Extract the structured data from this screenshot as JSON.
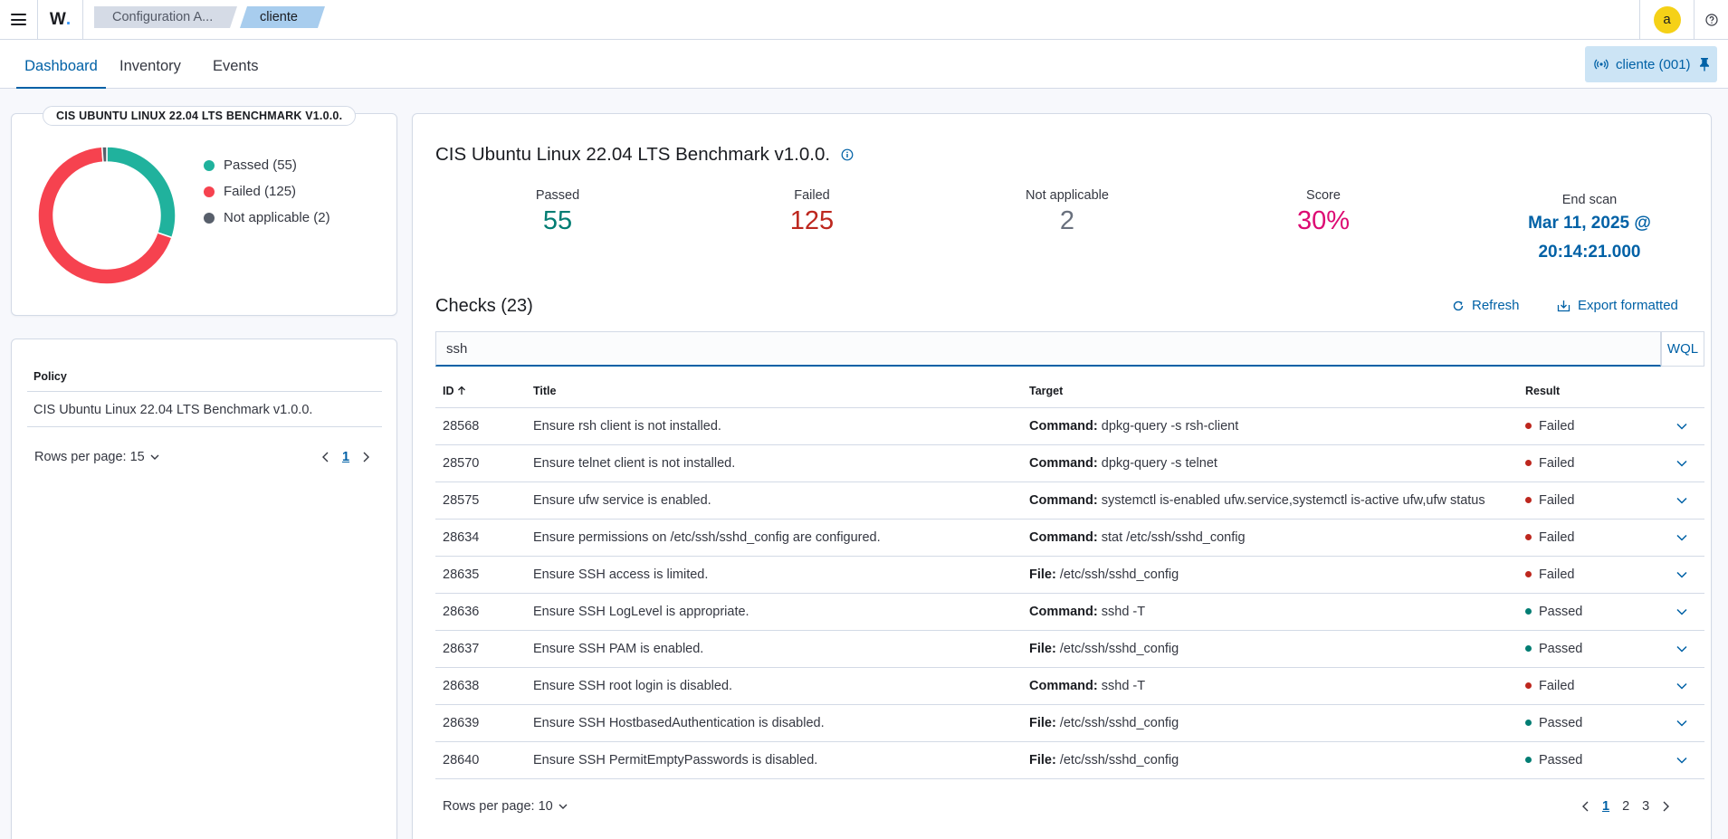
{
  "header": {
    "logo": "W",
    "breadcrumbs": [
      "Configuration A...",
      "cliente"
    ],
    "avatar_letter": "a"
  },
  "tabs": [
    {
      "label": "Dashboard",
      "active": true
    },
    {
      "label": "Inventory",
      "active": false
    },
    {
      "label": "Events",
      "active": false
    }
  ],
  "agent_pill": {
    "label": "cliente (001)"
  },
  "donut": {
    "title": "CIS UBUNTU LINUX 22.04 LTS BENCHMARK V1.0.0.",
    "legend": [
      "Passed (55)",
      "Failed (125)",
      "Not applicable (2)"
    ]
  },
  "chart_data": {
    "type": "pie",
    "title": "CIS UBUNTU LINUX 22.04 LTS BENCHMARK V1.0.0.",
    "categories": [
      "Passed",
      "Failed",
      "Not applicable"
    ],
    "values": [
      55,
      125,
      2
    ],
    "colors": [
      "#20b29d",
      "#f6424f",
      "#585f6b"
    ],
    "legend": "right"
  },
  "policy_table": {
    "header": "Policy",
    "rows": [
      "CIS Ubuntu Linux 22.04 LTS Benchmark v1.0.0."
    ],
    "rows_per_page": "Rows per page: 15",
    "pages": [
      "1"
    ]
  },
  "summary": {
    "title": "CIS Ubuntu Linux 22.04 LTS Benchmark v1.0.0.",
    "stats": [
      {
        "label": "Passed",
        "value": "55",
        "color": "#017d73"
      },
      {
        "label": "Failed",
        "value": "125",
        "color": "#bd271e"
      },
      {
        "label": "Not applicable",
        "value": "2",
        "color": "#69707d"
      },
      {
        "label": "Score",
        "value": "30%",
        "color": "#dd0a73"
      }
    ],
    "end_scan": {
      "label": "End scan",
      "line1": "Mar 11, 2025 @",
      "line2": "20:14:21.000"
    }
  },
  "checks": {
    "title": "Checks (23)",
    "refresh_label": "Refresh",
    "export_label": "Export formatted",
    "search_value": "ssh",
    "wql_label": "WQL",
    "columns": [
      "ID",
      "Title",
      "Target",
      "Result"
    ],
    "rows": [
      {
        "id": "28568",
        "title": "Ensure rsh client is not installed.",
        "target_key": "Command:",
        "target_val": " dpkg-query -s rsh-client",
        "result": "Failed"
      },
      {
        "id": "28570",
        "title": "Ensure telnet client is not installed.",
        "target_key": "Command:",
        "target_val": " dpkg-query -s telnet",
        "result": "Failed"
      },
      {
        "id": "28575",
        "title": "Ensure ufw service is enabled.",
        "target_key": "Command:",
        "target_val": " systemctl is-enabled ufw.service,systemctl is-active ufw,ufw status",
        "result": "Failed"
      },
      {
        "id": "28634",
        "title": "Ensure permissions on /etc/ssh/sshd_config are configured.",
        "target_key": "Command:",
        "target_val": " stat /etc/ssh/sshd_config",
        "result": "Failed"
      },
      {
        "id": "28635",
        "title": "Ensure SSH access is limited.",
        "target_key": "File:",
        "target_val": " /etc/ssh/sshd_config",
        "result": "Failed"
      },
      {
        "id": "28636",
        "title": "Ensure SSH LogLevel is appropriate.",
        "target_key": "Command:",
        "target_val": " sshd -T",
        "result": "Passed"
      },
      {
        "id": "28637",
        "title": "Ensure SSH PAM is enabled.",
        "target_key": "File:",
        "target_val": " /etc/ssh/sshd_config",
        "result": "Passed"
      },
      {
        "id": "28638",
        "title": "Ensure SSH root login is disabled.",
        "target_key": "Command:",
        "target_val": " sshd -T",
        "result": "Failed"
      },
      {
        "id": "28639",
        "title": "Ensure SSH HostbasedAuthentication is disabled.",
        "target_key": "File:",
        "target_val": " /etc/ssh/sshd_config",
        "result": "Passed"
      },
      {
        "id": "28640",
        "title": "Ensure SSH PermitEmptyPasswords is disabled.",
        "target_key": "File:",
        "target_val": " /etc/ssh/sshd_config",
        "result": "Passed"
      }
    ],
    "result_colors": {
      "Failed": "#bd271e",
      "Passed": "#017d73"
    },
    "rows_per_page": "Rows per page: 10",
    "pages": [
      "1",
      "2",
      "3"
    ]
  },
  "colors": {
    "accent": "#0061a6"
  }
}
